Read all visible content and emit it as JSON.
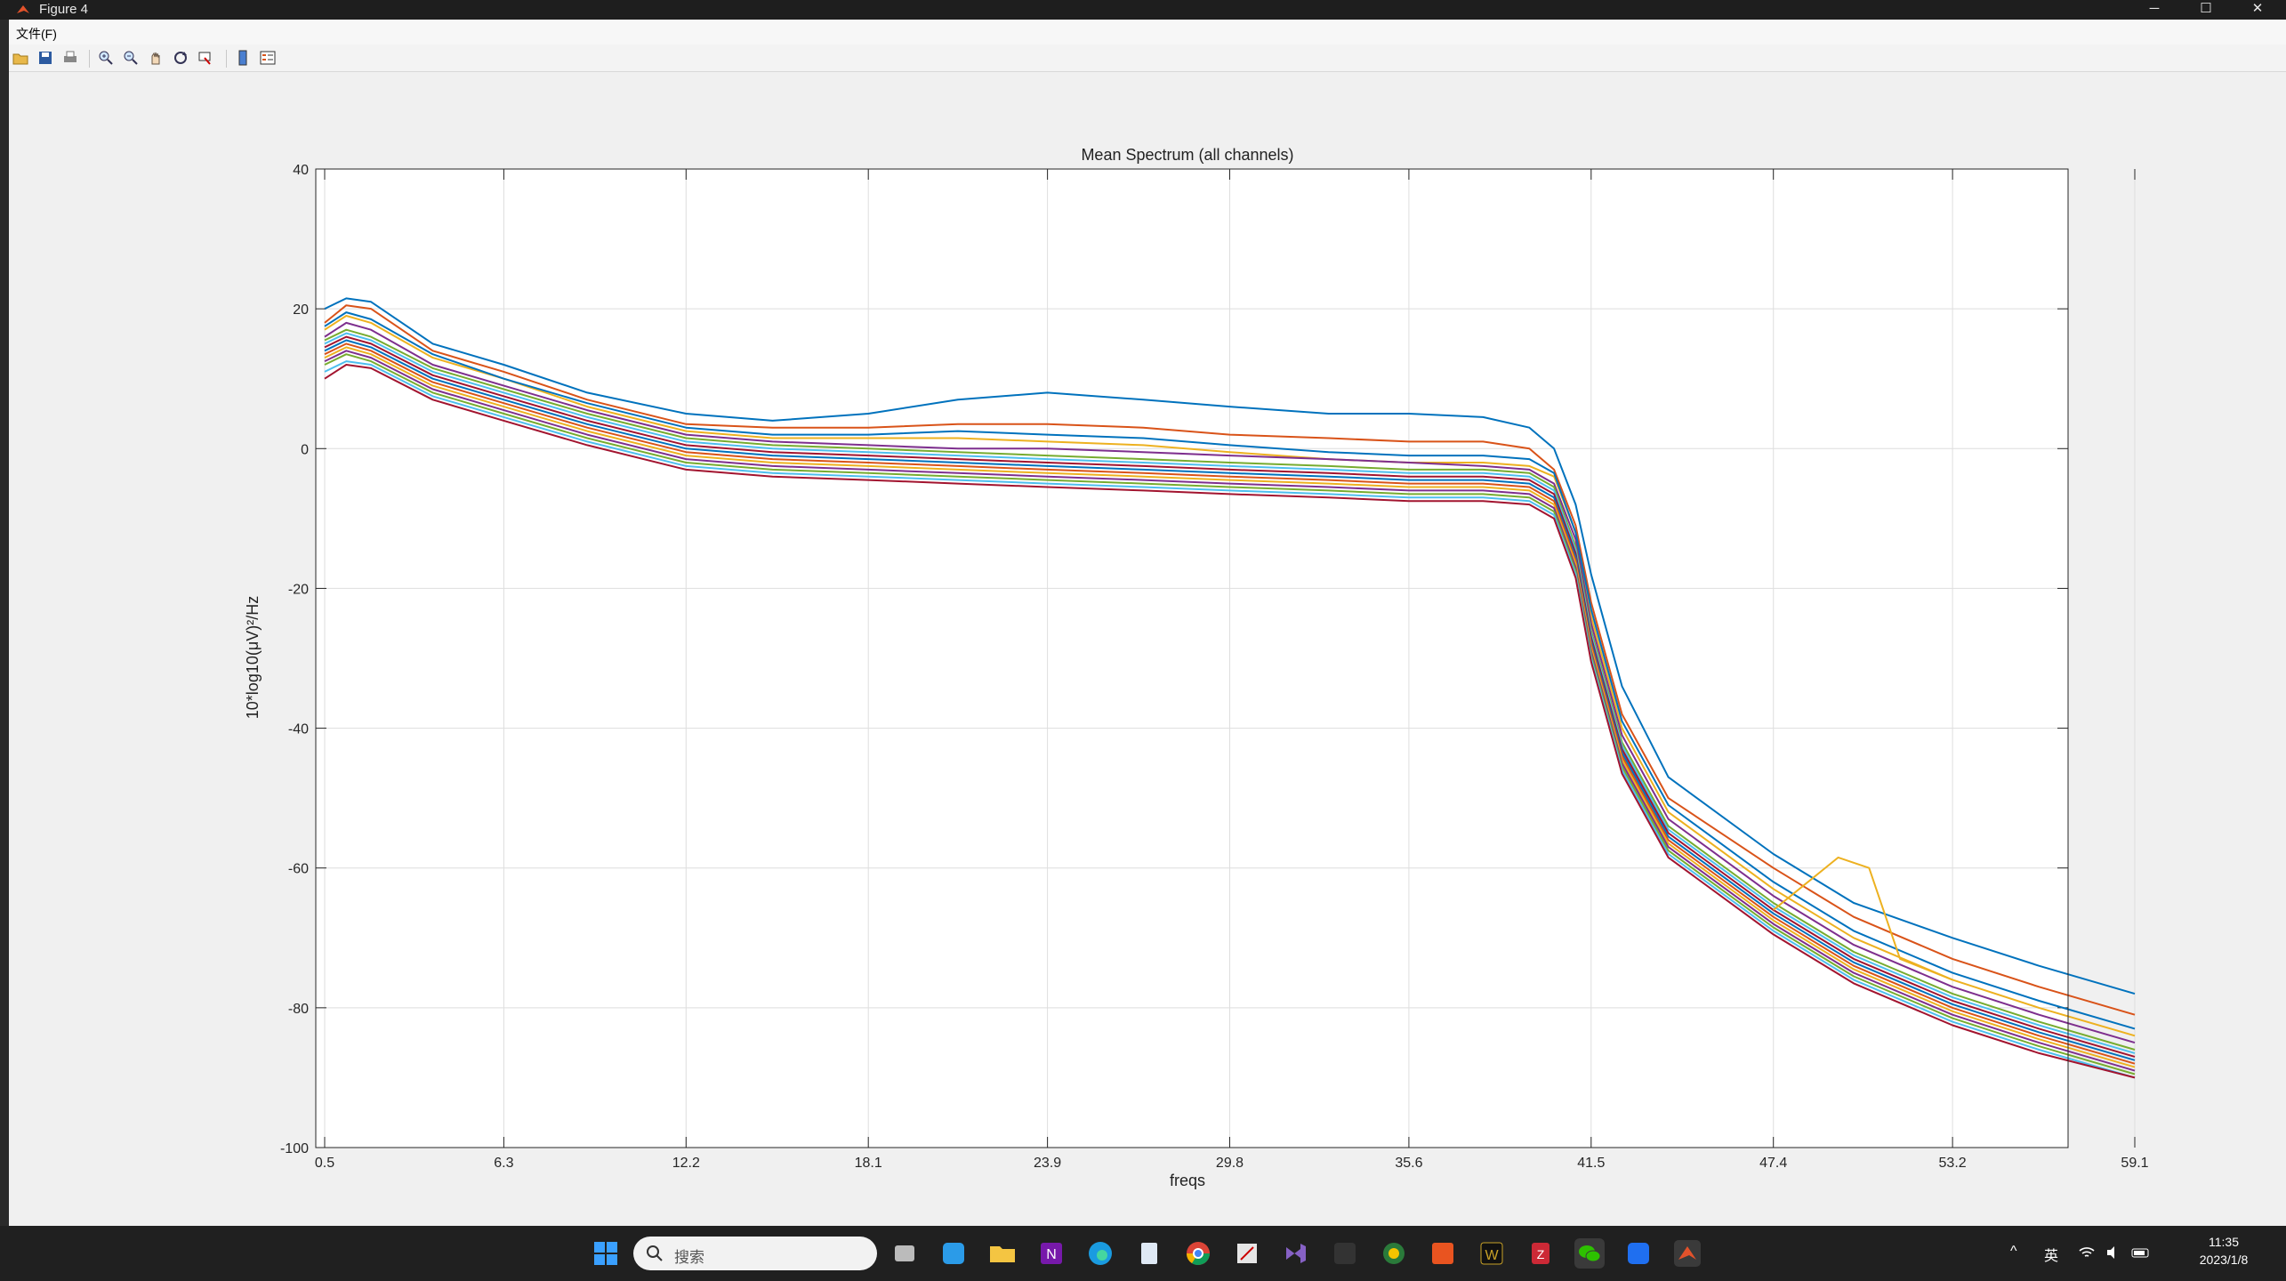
{
  "window": {
    "title": "Figure 4",
    "minimize_glyph": "─",
    "maximize_glyph": "☐",
    "close_glyph": "✕"
  },
  "menubar": {
    "file_label": "文件(F)"
  },
  "toolbar": {
    "buttons": [
      "open-icon",
      "save-icon",
      "print-icon",
      "zoom-in-icon",
      "zoom-out-icon",
      "pan-icon",
      "rotate-icon",
      "data-cursor-icon",
      "colorbar-icon",
      "legend-icon"
    ]
  },
  "colors": {
    "series": [
      "#0072BD",
      "#D95319",
      "#EDB120",
      "#7E2F8E",
      "#77AC30",
      "#4DBEEE",
      "#A2142F"
    ]
  },
  "chart_data": {
    "type": "line",
    "title": "Mean Spectrum (all channels)",
    "xlabel": "freqs",
    "ylabel": "10*log10(μV)²/Hz",
    "xlim": [
      0,
      70
    ],
    "ylim": [
      -100,
      40
    ],
    "grid": true,
    "x_ticks": [
      0.5,
      6.3,
      12.2,
      18.1,
      23.9,
      29.8,
      35.6,
      41.5,
      47.4,
      53.2,
      59.1
    ],
    "x_tick_labels": [
      "0.5",
      "6.3",
      "12.2",
      "18.1",
      "23.9",
      "29.8",
      "35.6",
      "41.5",
      "47.4",
      "53.2",
      "59.1"
    ],
    "y_ticks": [
      40,
      20,
      0,
      -20,
      -40,
      -60,
      -80,
      -100
    ],
    "y_tick_labels": [
      "40",
      "20",
      "0",
      "-20",
      "-40",
      "-60",
      "-80",
      "-100"
    ],
    "x": [
      0.5,
      1.2,
      2,
      4,
      6.3,
      9,
      12.2,
      15,
      18.1,
      21,
      23.9,
      27,
      29.8,
      33,
      35.6,
      38,
      39.5,
      40.3,
      41,
      41.5,
      42.5,
      44,
      47.4,
      50,
      53.2,
      56,
      59.1
    ],
    "series": [
      {
        "values": [
          20,
          21.5,
          21,
          15,
          12,
          8,
          5,
          4,
          5,
          7,
          8,
          7,
          6,
          5,
          5,
          4.5,
          3,
          0,
          -8,
          -18,
          -34,
          -47,
          -58,
          -65,
          -70,
          -74,
          -78
        ]
      },
      {
        "values": [
          18,
          20.5,
          20,
          14,
          11,
          7,
          3.5,
          3,
          3,
          3.5,
          3.5,
          3,
          2,
          1.5,
          1,
          1,
          0,
          -3,
          -11,
          -22,
          -38,
          -50,
          -60,
          -67,
          -73,
          -77,
          -81
        ]
      },
      {
        "values": [
          17,
          19,
          18,
          13,
          10,
          6,
          2.5,
          1.5,
          1.5,
          1.5,
          1,
          0.5,
          -0.5,
          -1.5,
          -2,
          -2,
          -2.5,
          -4,
          -12,
          -24,
          -40,
          -52,
          -63,
          -70,
          -76,
          -80,
          -84
        ]
      },
      {
        "values": [
          16,
          18,
          17,
          12,
          9,
          5.5,
          2,
          1,
          0.5,
          0,
          0,
          -0.5,
          -1,
          -1.5,
          -2,
          -2.5,
          -3,
          -5,
          -13,
          -25,
          -41,
          -53,
          -64,
          -71,
          -77,
          -81,
          -85
        ]
      },
      {
        "values": [
          15.5,
          17,
          16,
          11.5,
          8.5,
          5,
          1.5,
          0.5,
          0,
          -0.5,
          -1,
          -1.5,
          -2,
          -2.5,
          -3,
          -3,
          -3.5,
          -5.5,
          -14,
          -26,
          -42,
          -54,
          -65,
          -72,
          -78,
          -82,
          -86
        ]
      },
      {
        "values": [
          15,
          16.5,
          15.5,
          11,
          8,
          4.5,
          1,
          0,
          -0.5,
          -1,
          -1.5,
          -2,
          -2.5,
          -3,
          -3.5,
          -3.5,
          -4,
          -6,
          -14.5,
          -26.5,
          -42.5,
          -54.5,
          -65.5,
          -72.5,
          -78.5,
          -82.5,
          -86.5
        ]
      },
      {
        "values": [
          14.5,
          16,
          15,
          10.5,
          7.5,
          4,
          0.5,
          -0.5,
          -1,
          -1.5,
          -2,
          -2.5,
          -3,
          -3.5,
          -4,
          -4,
          -4.5,
          -6.5,
          -15,
          -27,
          -43,
          -55,
          -66,
          -73,
          -79,
          -83,
          -87
        ]
      },
      {
        "values": [
          14,
          15.5,
          14.5,
          10,
          7,
          3.5,
          0,
          -1,
          -1.5,
          -2,
          -2.5,
          -3,
          -3.5,
          -4,
          -4.5,
          -4.5,
          -5,
          -7,
          -15.5,
          -27.5,
          -43.5,
          -55.5,
          -66.5,
          -73.5,
          -79.5,
          -83.5,
          -87.5
        ]
      },
      {
        "values": [
          13.5,
          15,
          14,
          9.5,
          6.5,
          3,
          -0.5,
          -1.5,
          -2,
          -2.5,
          -3,
          -3.5,
          -4,
          -4.5,
          -5,
          -5,
          -5.5,
          -7.5,
          -16,
          -28,
          -44,
          -56,
          -67,
          -74,
          -80,
          -84,
          -88
        ]
      },
      {
        "values": [
          13,
          14.5,
          13.5,
          9,
          6,
          2.5,
          -1,
          -2,
          -2.5,
          -3,
          -3.5,
          -4,
          -4.5,
          -5,
          -5.5,
          -5.5,
          -6,
          -8,
          -16.5,
          -28.5,
          -44.5,
          -56.5,
          -67.5,
          -74.5,
          -80.5,
          -84.5,
          -88.5
        ]
      },
      {
        "values": [
          12.5,
          14,
          13,
          8.5,
          5.5,
          2,
          -1.5,
          -2.5,
          -3,
          -3.5,
          -4,
          -4.5,
          -5,
          -5.5,
          -6,
          -6,
          -6.5,
          -8.5,
          -17,
          -29,
          -45,
          -57,
          -68,
          -75,
          -81,
          -85,
          -89
        ]
      },
      {
        "values": [
          12,
          13.5,
          12.5,
          8,
          5,
          1.5,
          -2,
          -3,
          -3.5,
          -4,
          -4.5,
          -5,
          -5.5,
          -6,
          -6.5,
          -6.5,
          -7,
          -9,
          -17.5,
          -29.5,
          -45.5,
          -57.5,
          -68.5,
          -75.5,
          -81.5,
          -85.5,
          -89.5
        ]
      },
      {
        "values": [
          11,
          12.5,
          12,
          7.5,
          4.5,
          1,
          -2.5,
          -3.5,
          -4,
          -4.5,
          -5,
          -5.5,
          -6,
          -6.5,
          -7,
          -7,
          -7.5,
          -9.5,
          -18,
          -30,
          -46,
          -58,
          -69,
          -76,
          -82,
          -86,
          -90
        ]
      },
      {
        "values": [
          10,
          12,
          11.5,
          7,
          4,
          0.5,
          -3,
          -4,
          -4.5,
          -5,
          -5.5,
          -6,
          -6.5,
          -7,
          -7.5,
          -7.5,
          -8,
          -10,
          -18.5,
          -30.5,
          -46.5,
          -58.5,
          -69.5,
          -76.5,
          -82.5,
          -86.5,
          -90
        ]
      },
      {
        "values": [
          17.5,
          19.5,
          18.5,
          13.5,
          10,
          6.5,
          3,
          2,
          2,
          2.5,
          2,
          1.5,
          0.5,
          -0.5,
          -1,
          -1,
          -1.5,
          -3.5,
          -12,
          -23,
          -39,
          -51,
          -62,
          -69,
          -75,
          -79,
          -83
        ]
      }
    ],
    "bump": {
      "x": [
        47.4,
        49.5,
        50.5,
        51.5,
        53.2
      ],
      "values": [
        -66,
        -58.5,
        -60,
        -73,
        -76
      ]
    }
  },
  "taskbar": {
    "search_label": "搜索",
    "clock_time": "11:35",
    "clock_date": "2023/1/8",
    "tray_lang": "英",
    "tray_chevron": "^",
    "icons": [
      "start-icon",
      "search-icon",
      "taskview-icon",
      "widgets-icon",
      "file-explorer-icon",
      "onenote-icon",
      "edge-icon",
      "notepad-icon",
      "chrome-icon",
      "snip-icon",
      "visual-studio-icon",
      "code-icon",
      "app-icon",
      "ubuntu-icon",
      "wps-icon",
      "zotero-icon",
      "wechat-icon",
      "feishu-icon",
      "matlab-icon"
    ]
  }
}
